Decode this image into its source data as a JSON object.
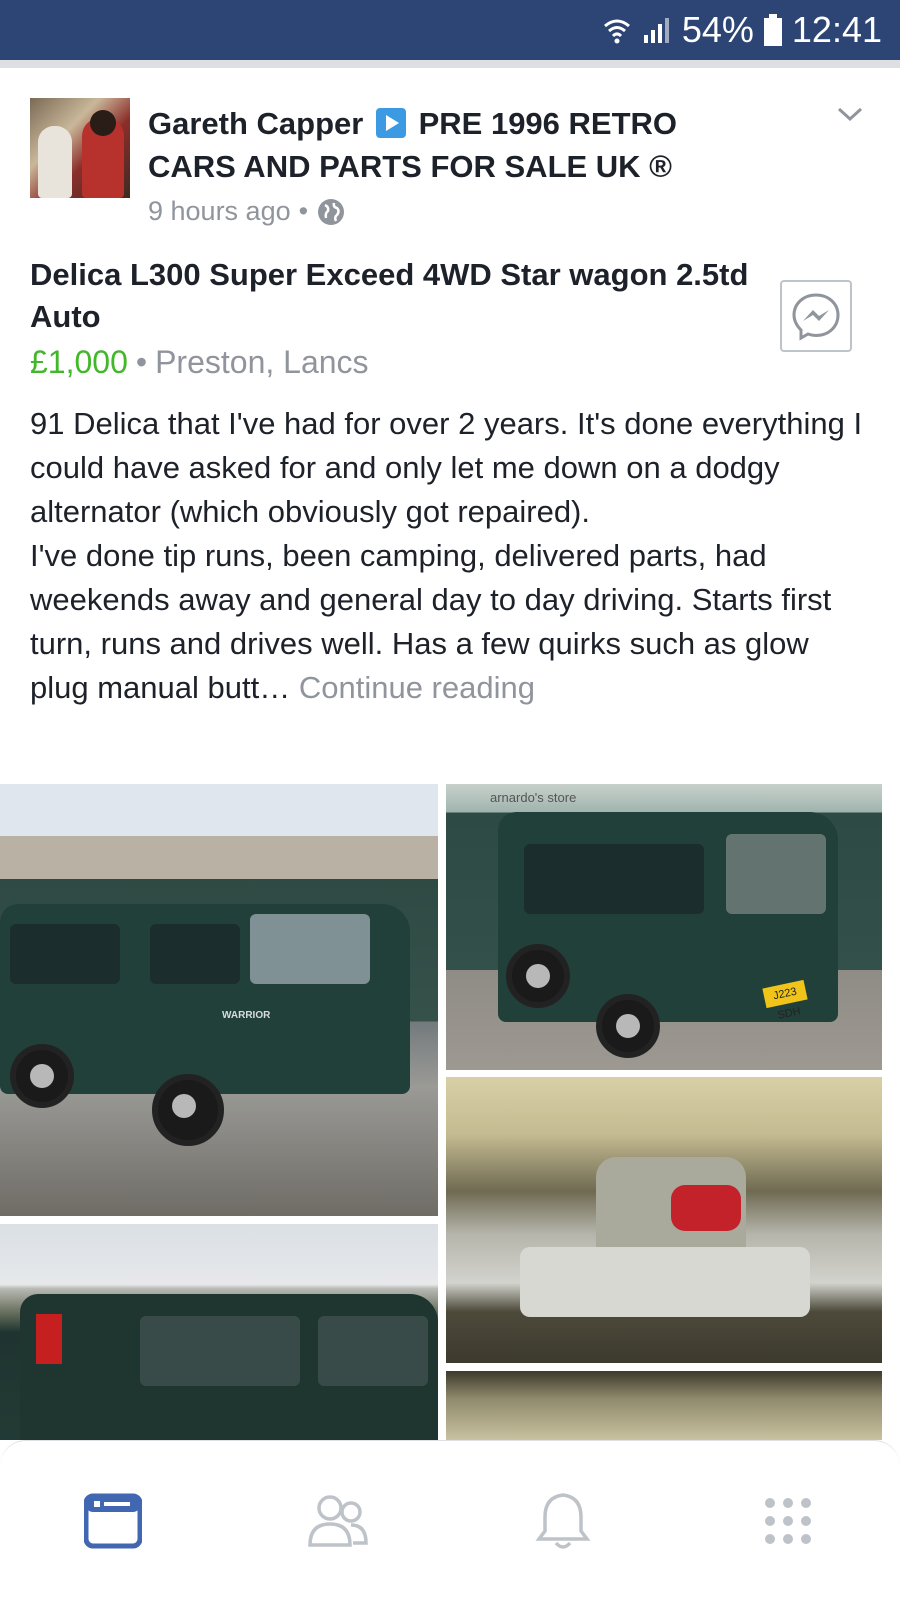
{
  "status_bar": {
    "battery": "54%",
    "time": "12:41"
  },
  "post": {
    "author_name": "Gareth Capper",
    "group_name": "PRE 1996 RETRO CARS AND PARTS FOR SALE UK ®",
    "timestamp": "9 hours ago",
    "listing_title": "Delica L300 Super Exceed 4WD Star wagon 2.5td Auto",
    "price": "£1,000",
    "separator": "•",
    "location": "Preston, Lancs",
    "description": "91 Delica that I've had for over 2 years.  It's done everything I could have asked for and only let me down on a dodgy alternator (which obviously got repaired).\nI've done tip runs, been camping, delivered parts, had weekends away and general day to day driving. Starts first turn, runs and drives well. Has a few quirks such as glow plug manual butt…",
    "continue_reading": "Continue reading",
    "photo_text": {
      "van_badge": "WARRIOR",
      "plate": "J223 SDH",
      "shop_sign": "arnardo's store"
    }
  },
  "tab_bar": {
    "tabs": [
      {
        "icon": "news-feed-icon",
        "active": true
      },
      {
        "icon": "friends-icon",
        "active": false
      },
      {
        "icon": "notifications-icon",
        "active": false
      },
      {
        "icon": "menu-grid-icon",
        "active": false
      }
    ],
    "active_color": "#4267b2",
    "inactive_color": "#bec2c9"
  },
  "colors": {
    "status_bar_bg": "#2d4575",
    "price_green": "#42b72a",
    "meta_gray": "#90949c"
  }
}
